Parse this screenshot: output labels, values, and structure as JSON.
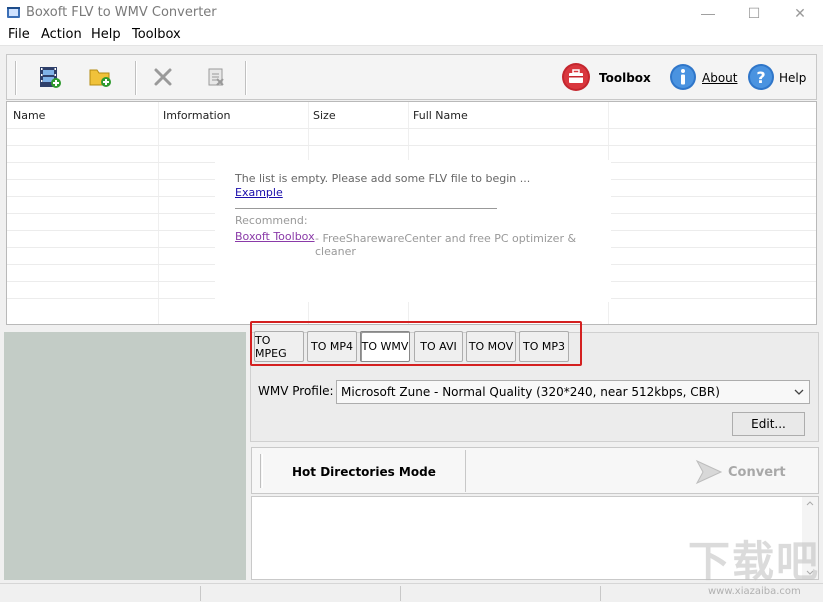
{
  "window": {
    "title": "Boxoft FLV to WMV Converter",
    "min_icon": "—",
    "max_icon": "☐",
    "close_icon": "✕"
  },
  "menu": [
    "File",
    "Action",
    "Help",
    "Toolbox"
  ],
  "toolbar": {
    "toolbox_label": "Toolbox",
    "about_label": "About",
    "help_label": "Help"
  },
  "file_list": {
    "columns": [
      "Name",
      "Imformation",
      "Size",
      "Full Name"
    ],
    "empty_message": "The list is empty. Please add some FLV file to begin ...",
    "example_link": "Example",
    "recommend_label": "Recommend:",
    "toolbox_link": "Boxoft Toolbox",
    "toolbox_desc": "- FreeSharewareCenter and free PC optimizer & cleaner"
  },
  "formats": {
    "buttons": [
      "TO MPEG",
      "TO MP4",
      "TO WMV",
      "TO AVI",
      "TO MOV",
      "TO MP3"
    ],
    "active": "TO WMV"
  },
  "profile": {
    "label": "WMV Profile:",
    "value": "Microsoft Zune - Normal Quality (320*240, near 512kbps, CBR)",
    "edit_label": "Edit..."
  },
  "hot_directories": {
    "mode_label": "Hot Directories Mode",
    "convert_label": "Convert"
  },
  "watermark": {
    "text": "下载吧",
    "url": "www.xiazaiba.com"
  },
  "colors": {
    "highlight": "#d42020",
    "preview_bg": "#c3ccc6",
    "link": "#1a0dab",
    "toolbox_link": "#8a3aa8"
  }
}
